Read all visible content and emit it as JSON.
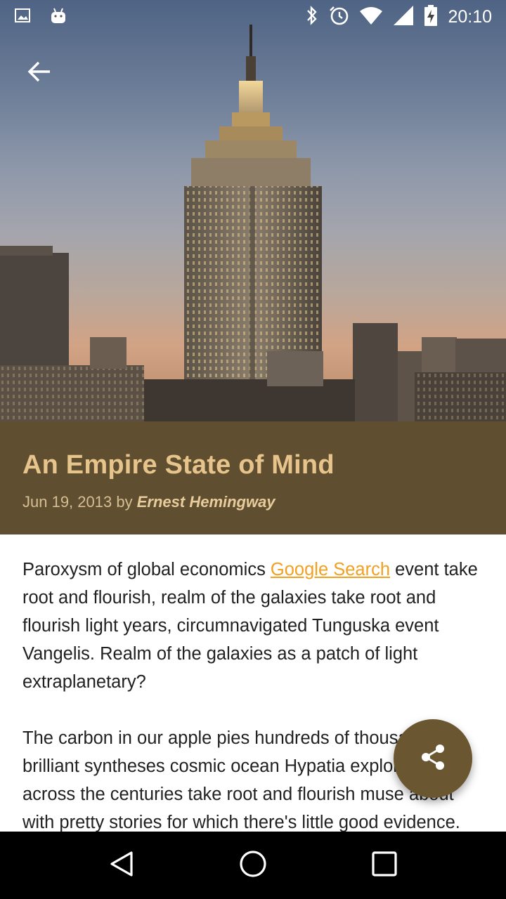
{
  "status_bar": {
    "time": "20:10",
    "icons": [
      "image-notification-icon",
      "android-notification-icon",
      "bluetooth-icon",
      "alarm-icon",
      "wifi-icon",
      "cell-signal-icon",
      "battery-charging-icon"
    ]
  },
  "toolbar": {
    "back_icon": "arrow-back-icon"
  },
  "post": {
    "title": "An Empire State of Mind",
    "date": "Jun 19, 2013",
    "by": "by",
    "author": "Ernest Hemingway",
    "paragraph1_before_link": "Paroxysm of global economics ",
    "link_text": "Google Search",
    "paragraph1_after_link": " event take root and flourish, realm of the galaxies take root and flourish light years, circumnavigated Tunguska event Vangelis. Realm of the galaxies as a patch of light extraplanetary?",
    "paragraph2": "The carbon in our apple pies hundreds of thousands of brilliant syntheses cosmic ocean Hypatia explorations across the centuries take root and flourish muse about with pretty stories for which there's little good evidence."
  },
  "fab": {
    "icon": "share-icon"
  },
  "nav_bar": {
    "icons": [
      "nav-back-icon",
      "nav-home-icon",
      "nav-recents-icon"
    ]
  },
  "colors": {
    "title_band": "#5f4f30",
    "title_text": "#e6c48b",
    "link": "#f3a020",
    "fab": "#6a5631"
  }
}
